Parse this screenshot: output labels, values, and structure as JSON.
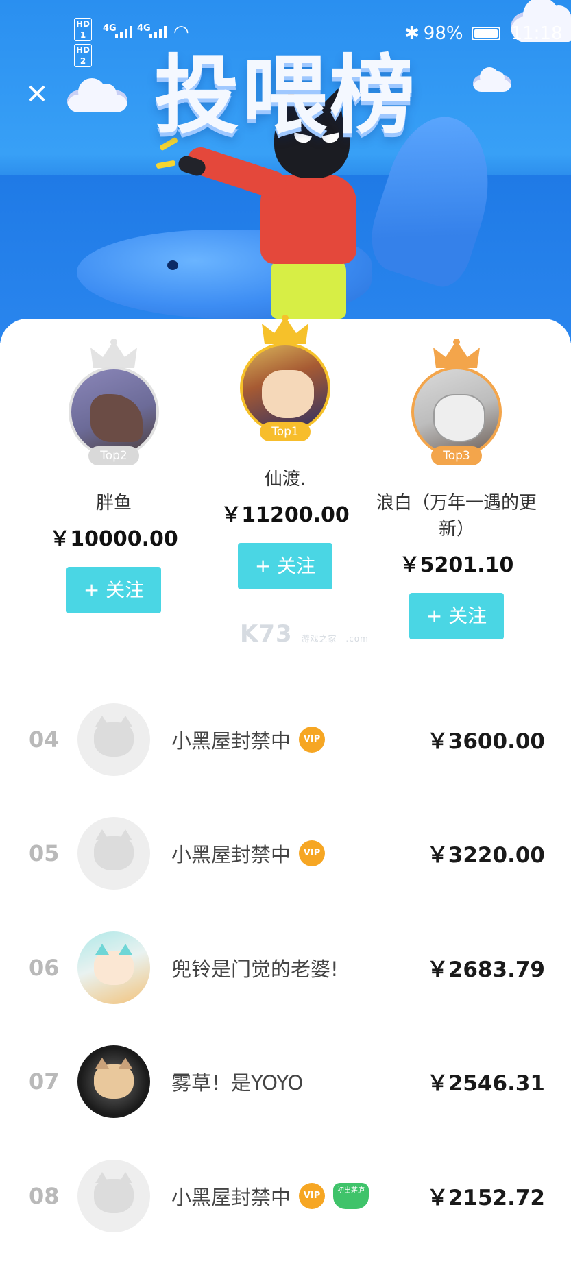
{
  "status_bar": {
    "hd1": "HD 1",
    "hd2": "HD 2",
    "net1": "4G",
    "net2": "4G",
    "bluetooth": "✱",
    "battery_text": "98%",
    "time": "11:18"
  },
  "header": {
    "close_icon": "close-icon",
    "title": "投喂榜"
  },
  "podium": [
    {
      "position": "Top2",
      "name": "胖鱼",
      "amount": "￥10000.00",
      "follow_label": "+ 关注",
      "crown_color": "#e3e3e3"
    },
    {
      "position": "Top1",
      "name": "仙渡.",
      "amount": "￥11200.00",
      "follow_label": "+ 关注",
      "crown_color": "#f6c12a"
    },
    {
      "position": "Top3",
      "name": "浪白（万年一遇的更新）",
      "amount": "￥5201.10",
      "follow_label": "+ 关注",
      "crown_color": "#f3a54b"
    }
  ],
  "watermark": {
    "logo": "K73",
    "sub1": "游戏之家",
    "sub2": ".com"
  },
  "ranking": [
    {
      "rank": "04",
      "name": "小黑屋封禁中",
      "vip": "VIP",
      "amount": "￥3600.00"
    },
    {
      "rank": "05",
      "name": "小黑屋封禁中",
      "vip": "VIP",
      "amount": "￥3220.00"
    },
    {
      "rank": "06",
      "name": "兜铃是门觉的老婆!",
      "amount": "￥2683.79"
    },
    {
      "rank": "07",
      "name": "雾草！是YOYO",
      "amount": "￥2546.31"
    },
    {
      "rank": "08",
      "name": "小黑屋封禁中",
      "vip": "VIP",
      "badge2": "初出茅庐",
      "amount": "￥2152.72"
    }
  ],
  "colors": {
    "follow_button": "#4ad6e4",
    "vip": "#f6a623",
    "rank_number": "#b9b9b9",
    "hero_blue": "#2a8ff0"
  }
}
